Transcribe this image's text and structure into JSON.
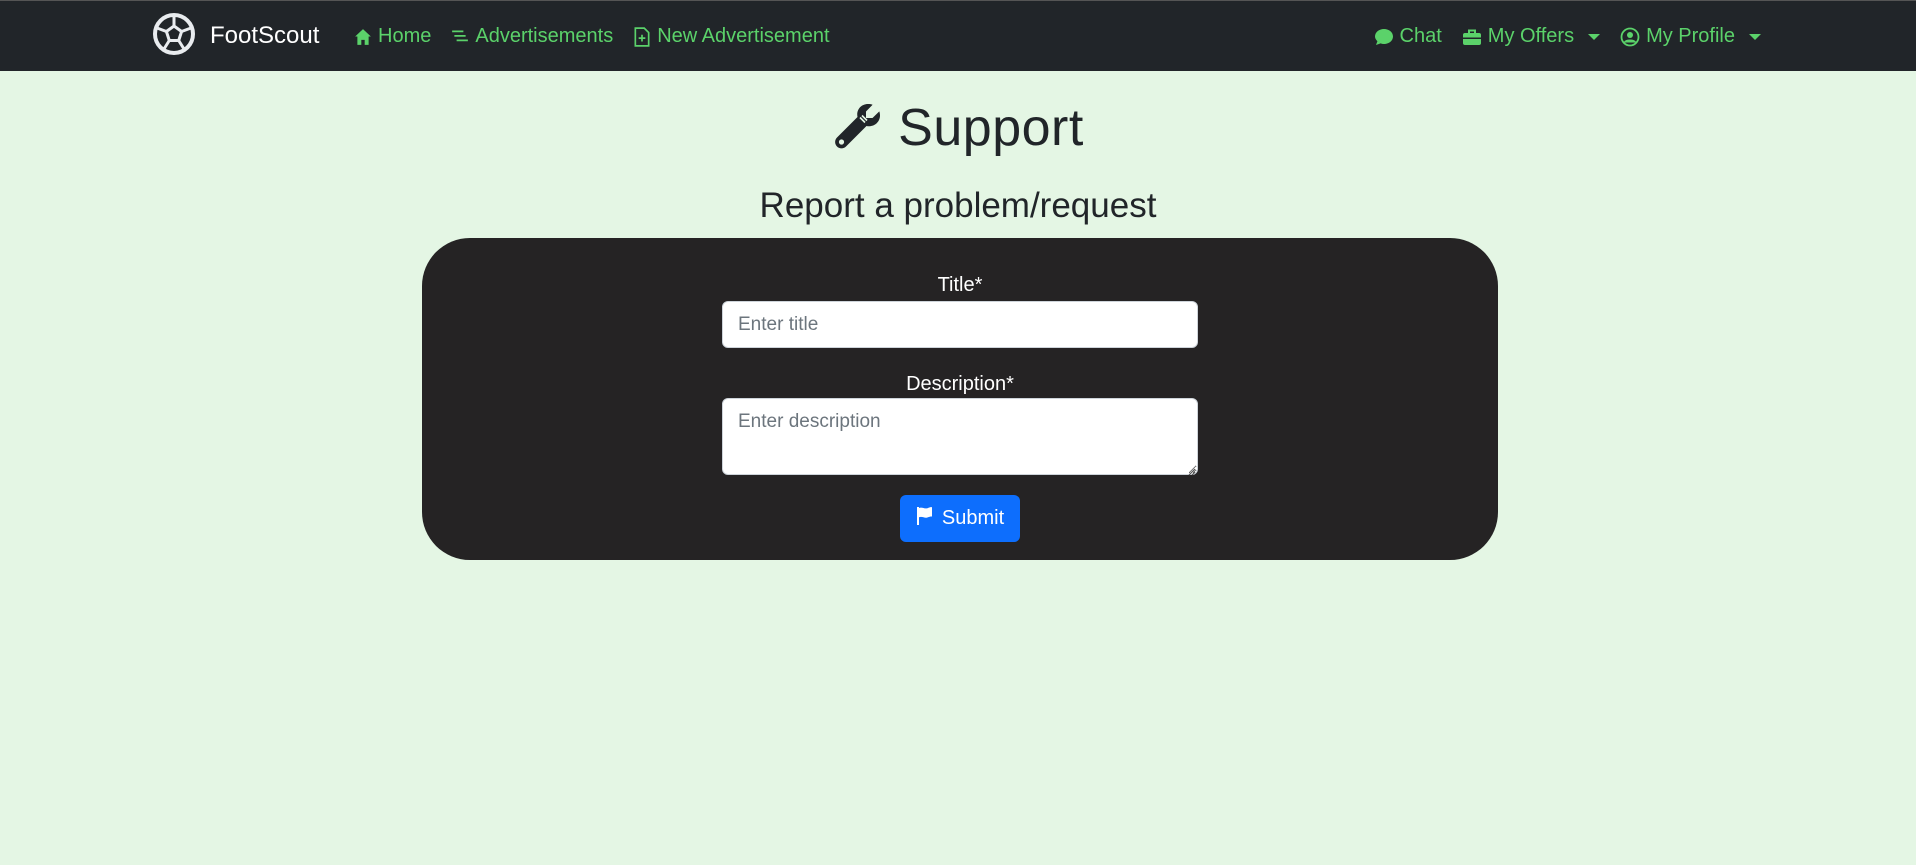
{
  "nav": {
    "brand": "FootScout",
    "links": [
      {
        "label": "Home",
        "icon": "home-icon"
      },
      {
        "label": "Advertisements",
        "icon": "list-icon"
      },
      {
        "label": "New Advertisement",
        "icon": "file-plus-icon"
      }
    ],
    "right": [
      {
        "label": "Chat",
        "icon": "chat-icon"
      },
      {
        "label": "My Offers",
        "icon": "briefcase-icon"
      },
      {
        "label": "My Profile",
        "icon": "user-circle-icon"
      }
    ],
    "accent_color": "#5bd26a"
  },
  "page": {
    "title": "Support",
    "title_icon": "wrench-icon",
    "section_title": "Report a problem/request"
  },
  "form": {
    "title_label": "Title*",
    "title_placeholder": "Enter title",
    "title_value": "",
    "description_label": "Description*",
    "description_placeholder": "Enter description",
    "description_value": "",
    "submit_label": "Submit",
    "submit_icon": "flag-icon",
    "submit_color": "#0d6efd"
  }
}
